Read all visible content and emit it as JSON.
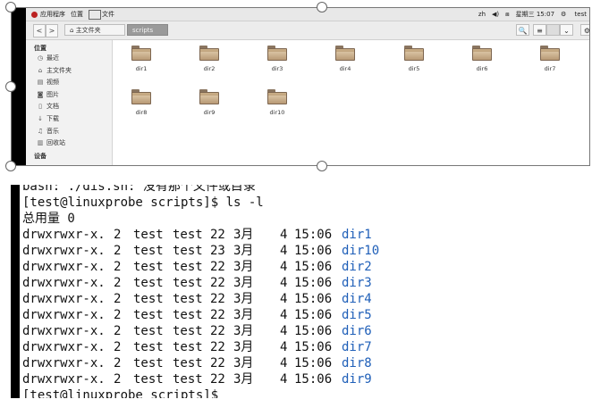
{
  "topbar": {
    "apps": "应用程序",
    "places": "位置",
    "files": "文件",
    "lang": "zh",
    "volume_icon": "volume-icon",
    "network_icon": "network-icon",
    "datetime": "星期三 15:07",
    "user": "test"
  },
  "toolbar": {
    "back": "<",
    "forward": ">",
    "home_crumb": "主文件夹",
    "current_crumb": "scripts"
  },
  "sidebar": {
    "places_header": "位置",
    "items": [
      {
        "label": "最近",
        "icon": "clock-icon"
      },
      {
        "label": "主文件夹",
        "icon": "home-icon"
      },
      {
        "label": "视频",
        "icon": "video-icon"
      },
      {
        "label": "图片",
        "icon": "camera-icon"
      },
      {
        "label": "文档",
        "icon": "document-icon"
      },
      {
        "label": "下载",
        "icon": "download-icon"
      },
      {
        "label": "音乐",
        "icon": "music-icon"
      },
      {
        "label": "回收站",
        "icon": "trash-icon"
      }
    ],
    "devices_header": "设备"
  },
  "folders": [
    "dir1",
    "dir2",
    "dir3",
    "dir4",
    "dir5",
    "dir6",
    "dir7",
    "dir8",
    "dir9",
    "dir10"
  ],
  "terminal": {
    "partial_top": "bash: ./dis.sh: 没有那个文件或目录",
    "prompt": "[test@linuxprobe scripts]$ ls -l",
    "total": "总用量 0",
    "rows": [
      {
        "perm": "drwxrwxr-x.",
        "links": "2",
        "user": "test",
        "group": "test",
        "size": "22",
        "month": "3月",
        "day": "4",
        "time": "15:06",
        "name": "dir1"
      },
      {
        "perm": "drwxrwxr-x.",
        "links": "2",
        "user": "test",
        "group": "test",
        "size": "23",
        "month": "3月",
        "day": "4",
        "time": "15:06",
        "name": "dir10"
      },
      {
        "perm": "drwxrwxr-x.",
        "links": "2",
        "user": "test",
        "group": "test",
        "size": "22",
        "month": "3月",
        "day": "4",
        "time": "15:06",
        "name": "dir2"
      },
      {
        "perm": "drwxrwxr-x.",
        "links": "2",
        "user": "test",
        "group": "test",
        "size": "22",
        "month": "3月",
        "day": "4",
        "time": "15:06",
        "name": "dir3"
      },
      {
        "perm": "drwxrwxr-x.",
        "links": "2",
        "user": "test",
        "group": "test",
        "size": "22",
        "month": "3月",
        "day": "4",
        "time": "15:06",
        "name": "dir4"
      },
      {
        "perm": "drwxrwxr-x.",
        "links": "2",
        "user": "test",
        "group": "test",
        "size": "22",
        "month": "3月",
        "day": "4",
        "time": "15:06",
        "name": "dir5"
      },
      {
        "perm": "drwxrwxr-x.",
        "links": "2",
        "user": "test",
        "group": "test",
        "size": "22",
        "month": "3月",
        "day": "4",
        "time": "15:06",
        "name": "dir6"
      },
      {
        "perm": "drwxrwxr-x.",
        "links": "2",
        "user": "test",
        "group": "test",
        "size": "22",
        "month": "3月",
        "day": "4",
        "time": "15:06",
        "name": "dir7"
      },
      {
        "perm": "drwxrwxr-x.",
        "links": "2",
        "user": "test",
        "group": "test",
        "size": "22",
        "month": "3月",
        "day": "4",
        "time": "15:06",
        "name": "dir8"
      },
      {
        "perm": "drwxrwxr-x.",
        "links": "2",
        "user": "test",
        "group": "test",
        "size": "22",
        "month": "3月",
        "day": "4",
        "time": "15:06",
        "name": "dir9"
      }
    ],
    "partial_bottom": "[test@linuxprobe scripts]$"
  },
  "colors": {
    "link_blue": "#1f5fb8",
    "crumb_active": "#9a9a9a"
  }
}
